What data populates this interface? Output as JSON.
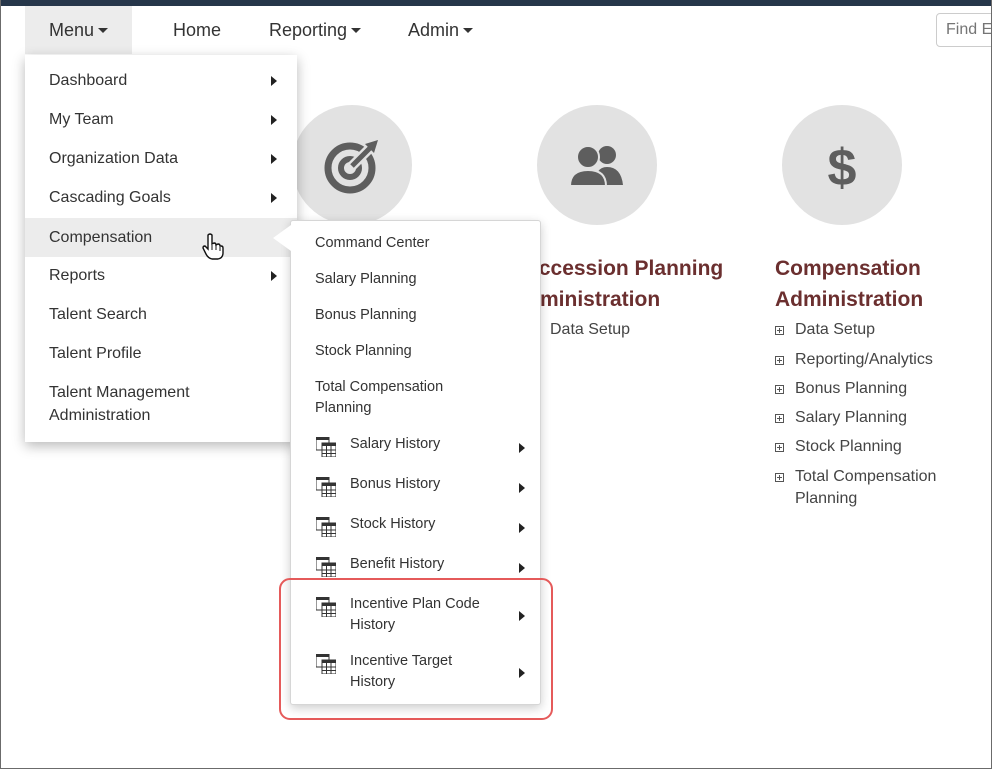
{
  "nav": {
    "menu": "Menu",
    "home": "Home",
    "reporting": "Reporting",
    "admin": "Admin",
    "search_placeholder": "Find E"
  },
  "dropdown": {
    "items": [
      {
        "label": "Dashboard",
        "has_submenu": true
      },
      {
        "label": "My Team",
        "has_submenu": true
      },
      {
        "label": "Organization Data",
        "has_submenu": true
      },
      {
        "label": "Cascading Goals",
        "has_submenu": true
      },
      {
        "label": "Compensation",
        "has_submenu": false
      },
      {
        "label": "Reports",
        "has_submenu": true
      },
      {
        "label": "Talent Search",
        "has_submenu": false
      },
      {
        "label": "Talent Profile",
        "has_submenu": false
      },
      {
        "label": "Talent Management",
        "label2": "Administration",
        "has_submenu": false
      }
    ]
  },
  "submenu": {
    "items": [
      {
        "label": "Command Center"
      },
      {
        "label": "Salary Planning"
      },
      {
        "label": "Bonus Planning"
      },
      {
        "label": "Stock Planning"
      },
      {
        "label": "Total Compensation",
        "label2": "Planning"
      },
      {
        "label": "Salary History",
        "icon": "table-icon"
      },
      {
        "label": "Bonus History",
        "icon": "table-icon"
      },
      {
        "label": "Stock History",
        "icon": "table-icon"
      },
      {
        "label": "Benefit History",
        "icon": "table-icon"
      },
      {
        "label": "Incentive Plan Code",
        "label2": "History",
        "icon": "table-icon"
      },
      {
        "label": "Incentive Target",
        "label2": "History",
        "icon": "table-icon"
      }
    ]
  },
  "modules": {
    "goals": {
      "icon": "goal-target-icon"
    },
    "succession": {
      "icon": "people-icon",
      "title_line1": "Succession Planning",
      "title_line2": "Administration",
      "items": [
        "Data Setup"
      ]
    },
    "compensation": {
      "icon": "dollar-icon",
      "title_line1": "Compensation",
      "title_line2": "Administration",
      "items": [
        "Data Setup",
        "Reporting/Analytics",
        "Bonus Planning",
        "Salary Planning",
        "Stock Planning",
        "Total Compensation",
        "Planning"
      ]
    }
  },
  "colors": {
    "accent_title": "#6b2f2f",
    "highlight_border": "#e55a5a",
    "top_stripe": "#26364a"
  }
}
